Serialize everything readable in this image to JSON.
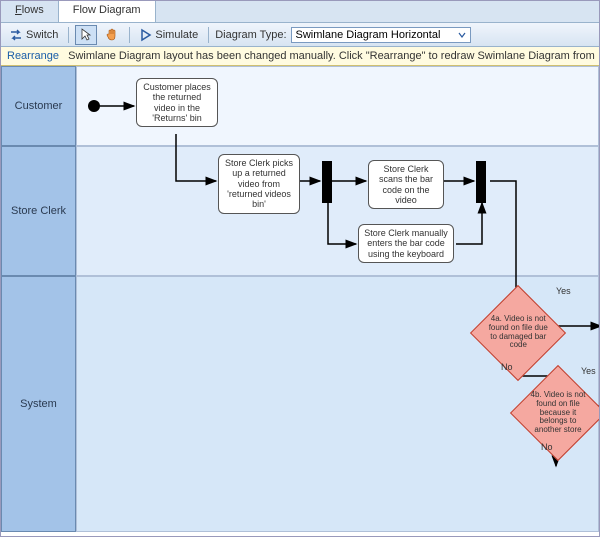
{
  "tabs": {
    "flows": "Flows",
    "flow_diagram": "Flow Diagram"
  },
  "toolbar": {
    "switch_label": "Switch",
    "simulate_label": "Simulate",
    "diagram_type_label": "Diagram Type:",
    "diagram_type_value": "Swimlane Diagram Horizontal"
  },
  "message": {
    "link": "Rearrange",
    "text": "Swimlane Diagram layout has been changed manually. Click \"Rearrange\" to redraw Swimlane Diagram from"
  },
  "lanes": {
    "customer": "Customer",
    "store_clerk": "Store Clerk",
    "system": "System"
  },
  "nodes": {
    "n1": "Customer places the returned video in the 'Returns' bin",
    "n2": "Store Clerk picks up a returned video from 'returned videos bin'",
    "n3": "Store Clerk scans the bar code on the video",
    "n4": "Store Clerk manually enters the bar code using the keyboard",
    "d1": "4a. Video is not found on file due to damaged bar code",
    "d2": "4b. Video is not found on file because it belongs to another store"
  },
  "labels": {
    "yes": "Yes",
    "no": "No"
  }
}
